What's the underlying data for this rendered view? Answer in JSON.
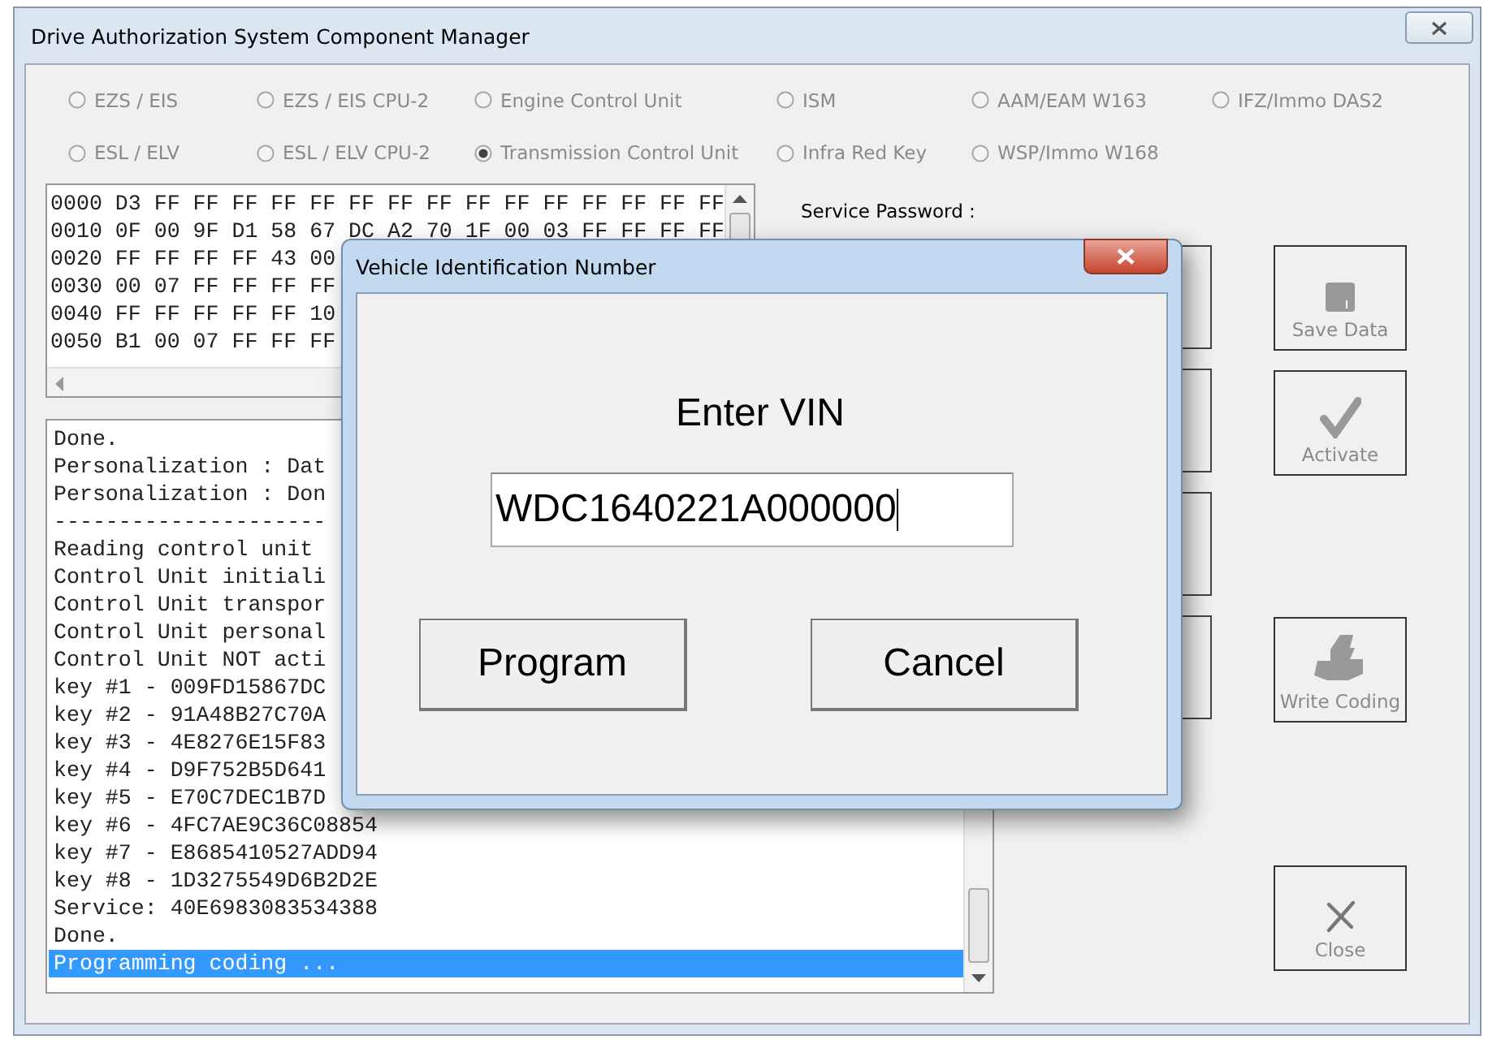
{
  "window": {
    "title": "Drive Authorization System Component Manager"
  },
  "unit_options": [
    {
      "label": "EZS / EIS",
      "selected": false,
      "disabled": true
    },
    {
      "label": "EZS / EIS CPU-2",
      "selected": false,
      "disabled": true
    },
    {
      "label": "Engine Control Unit",
      "selected": false,
      "disabled": true
    },
    {
      "label": "ISM",
      "selected": false,
      "disabled": true
    },
    {
      "label": "AAM/EAM W163",
      "selected": false,
      "disabled": true
    },
    {
      "label": "IFZ/Immo DAS2",
      "selected": false,
      "disabled": true
    },
    {
      "label": "ESL / ELV",
      "selected": false,
      "disabled": true
    },
    {
      "label": "ESL / ELV CPU-2",
      "selected": false,
      "disabled": true
    },
    {
      "label": "Transmission Control Unit",
      "selected": true,
      "disabled": true
    },
    {
      "label": "Infra Red Key",
      "selected": false,
      "disabled": true
    },
    {
      "label": "WSP/Immo W168",
      "selected": false,
      "disabled": true
    }
  ],
  "hex_dump": {
    "rows": [
      "0000 D3 FF FF FF FF FF FF FF FF FF FF FF FF FF FF FF",
      "0010 0F 00 9F D1 58 67 DC A2 70 1F 00 03 FF FF FF FF",
      "0020 FF FF FF FF 43 00",
      "0030 00 07 FF FF FF FF",
      "0040 FF FF FF FF FF 10",
      "0050 B1 00 07 FF FF FF"
    ]
  },
  "service_password": {
    "label": "Service Password :"
  },
  "log": {
    "lines": [
      {
        "text": "Done.",
        "selected": false
      },
      {
        "text": "Personalization : Dat",
        "selected": false
      },
      {
        "text": "Personalization : Don",
        "selected": false
      },
      {
        "text": "---------------------",
        "selected": false
      },
      {
        "text": "Reading control unit",
        "selected": false
      },
      {
        "text": "Control Unit initiali",
        "selected": false
      },
      {
        "text": "Control Unit transpor",
        "selected": false
      },
      {
        "text": "Control Unit personal",
        "selected": false
      },
      {
        "text": "Control Unit NOT acti",
        "selected": false
      },
      {
        "text": "key #1 - 009FD15867DC",
        "selected": false
      },
      {
        "text": "key #2 - 91A48B27C70A",
        "selected": false
      },
      {
        "text": "key #3 - 4E8276E15F83",
        "selected": false
      },
      {
        "text": "key #4 - D9F752B5D641",
        "selected": false
      },
      {
        "text": "key #5 - E70C7DEC1B7D",
        "selected": false
      },
      {
        "text": "key #6 - 4FC7AE9C36C08854",
        "selected": false
      },
      {
        "text": "key #7 - E8685410527ADD94",
        "selected": false
      },
      {
        "text": "key #8 - 1D3275549D6B2D2E",
        "selected": false
      },
      {
        "text": "Service: 40E6983083534388",
        "selected": false
      },
      {
        "text": "Done.",
        "selected": false
      },
      {
        "text": "Programming coding ...",
        "selected": true
      }
    ]
  },
  "side_buttons": [
    {
      "label": "Save Data",
      "kind": "save",
      "disabled": true
    },
    {
      "label": "Activate",
      "kind": "check",
      "disabled": true
    },
    {
      "label": "Write Coding",
      "kind": "coding",
      "disabled": true
    },
    {
      "label": "Close",
      "kind": "close",
      "disabled": true
    }
  ],
  "dialog": {
    "title": "Vehicle Identification Number",
    "prompt": "Enter VIN",
    "vin": "WDC1640221A000000",
    "buttons": [
      "Program",
      "Cancel"
    ]
  }
}
